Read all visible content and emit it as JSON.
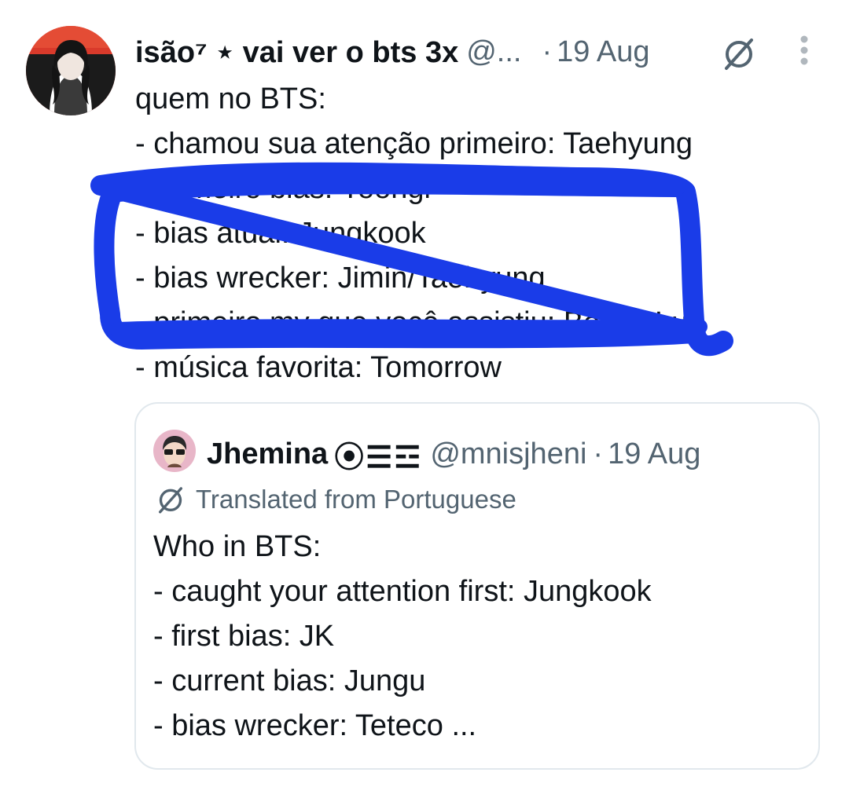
{
  "tweet": {
    "display_name": "isão⁷ ⋆ vai ver o bts 3x",
    "handle": "@...",
    "dot": "·",
    "date": "19 Aug",
    "lines": [
      "quem no BTS:",
      "- chamou sua atenção primeiro: Taehyung",
      "- primeiro bias: Yoongi",
      "- bias atual: Jungkook",
      "- bias wrecker: Jimin/Taehyung",
      "- primeiro mv que você assistiu: Boy in Luv",
      "- música favorita: Tomorrow"
    ]
  },
  "quote": {
    "display_name": "Jhemina",
    "symbols": "⦿☰☲",
    "handle": "@mnisjheni",
    "dot": "·",
    "date": "19 Aug",
    "translated_label": "Translated from Portuguese",
    "lines": [
      "Who in BTS:",
      "- caught your attention first: Jungkook",
      "- first bias: JK",
      "- current bias: Jungu",
      "- bias wrecker: Teteco ..."
    ]
  },
  "colors": {
    "annotation_blue": "#1a3ce8",
    "muted_text": "#536471",
    "border": "#e1e8ed"
  },
  "icons": {
    "translate": "translate-icon",
    "more": "more-vertical-icon"
  }
}
